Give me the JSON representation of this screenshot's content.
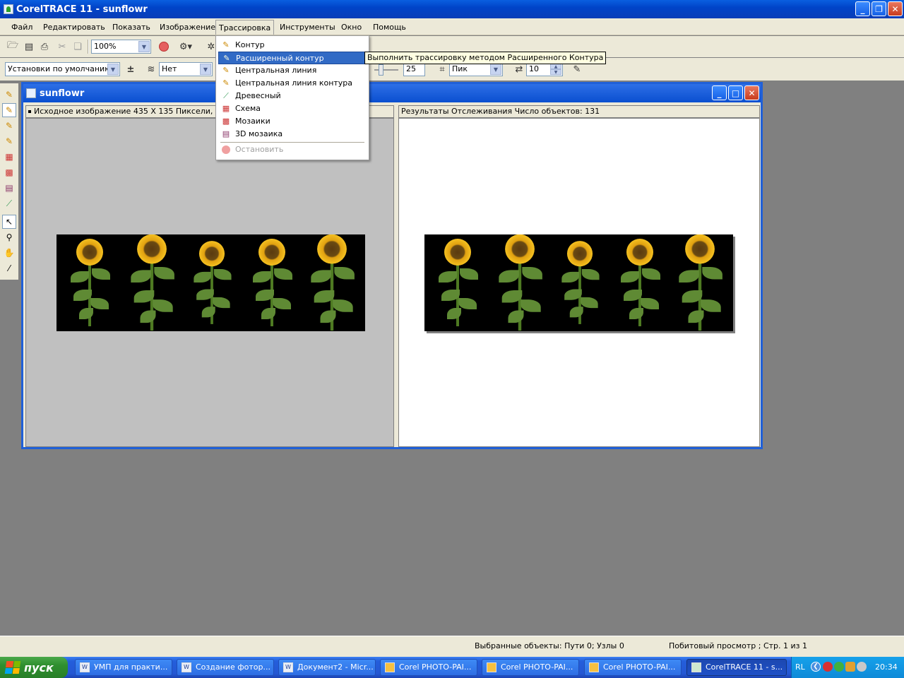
{
  "app": {
    "title": "CorelTRACE 11 - sunflowr"
  },
  "menubar": {
    "items": [
      "Файл",
      "Редактировать",
      "Показать",
      "Изображение",
      "Трассировка",
      "Инструменты",
      "Окно",
      "Помощь"
    ]
  },
  "toolbar1": {
    "zoom": "100%"
  },
  "toolbar2": {
    "preset": "Установки по умолчанию",
    "smoothing": "Нет",
    "slider_value": "25",
    "node_type": "Пик",
    "count_value": "10"
  },
  "trace_menu": {
    "items": [
      "Контур",
      "Расширенный контур",
      "Центральная линия",
      "Центральная линия контура",
      "Древесный",
      "Схема",
      "Мозаики",
      "3D мозаика",
      "Остановить"
    ],
    "highlighted": "Расширенный контур",
    "tooltip": "Выполнить трассировку методом Расширенного Контура"
  },
  "document": {
    "title": "sunflowr",
    "source_header": "Исходное изображение   435 X 135 Пиксели, 24-би",
    "result_header": "Результаты Отслеживания   Число объектов: 131"
  },
  "statusbar": {
    "selection": "Выбранные объекты: Пути 0; Узлы 0",
    "view": "Побитовый просмотр ; Стр. 1 из 1"
  },
  "taskbar": {
    "start_label": "пуск",
    "tasks": [
      "УМП для практи...",
      "Создание фотор...",
      "Документ2 - Micr...",
      "Corel PHOTO-PAI...",
      "Corel PHOTO-PAI...",
      "Corel PHOTO-PAI...",
      "CorelTRACE 11 - s..."
    ],
    "lang": "RL",
    "clock": "20:34"
  },
  "colors": {
    "title_blue": "#0a5fe0",
    "highlight": "#316ac5",
    "chrome": "#ece9d8",
    "workspace": "#808080",
    "taskbar": "#245edb",
    "start_green": "#2f8f2f"
  }
}
